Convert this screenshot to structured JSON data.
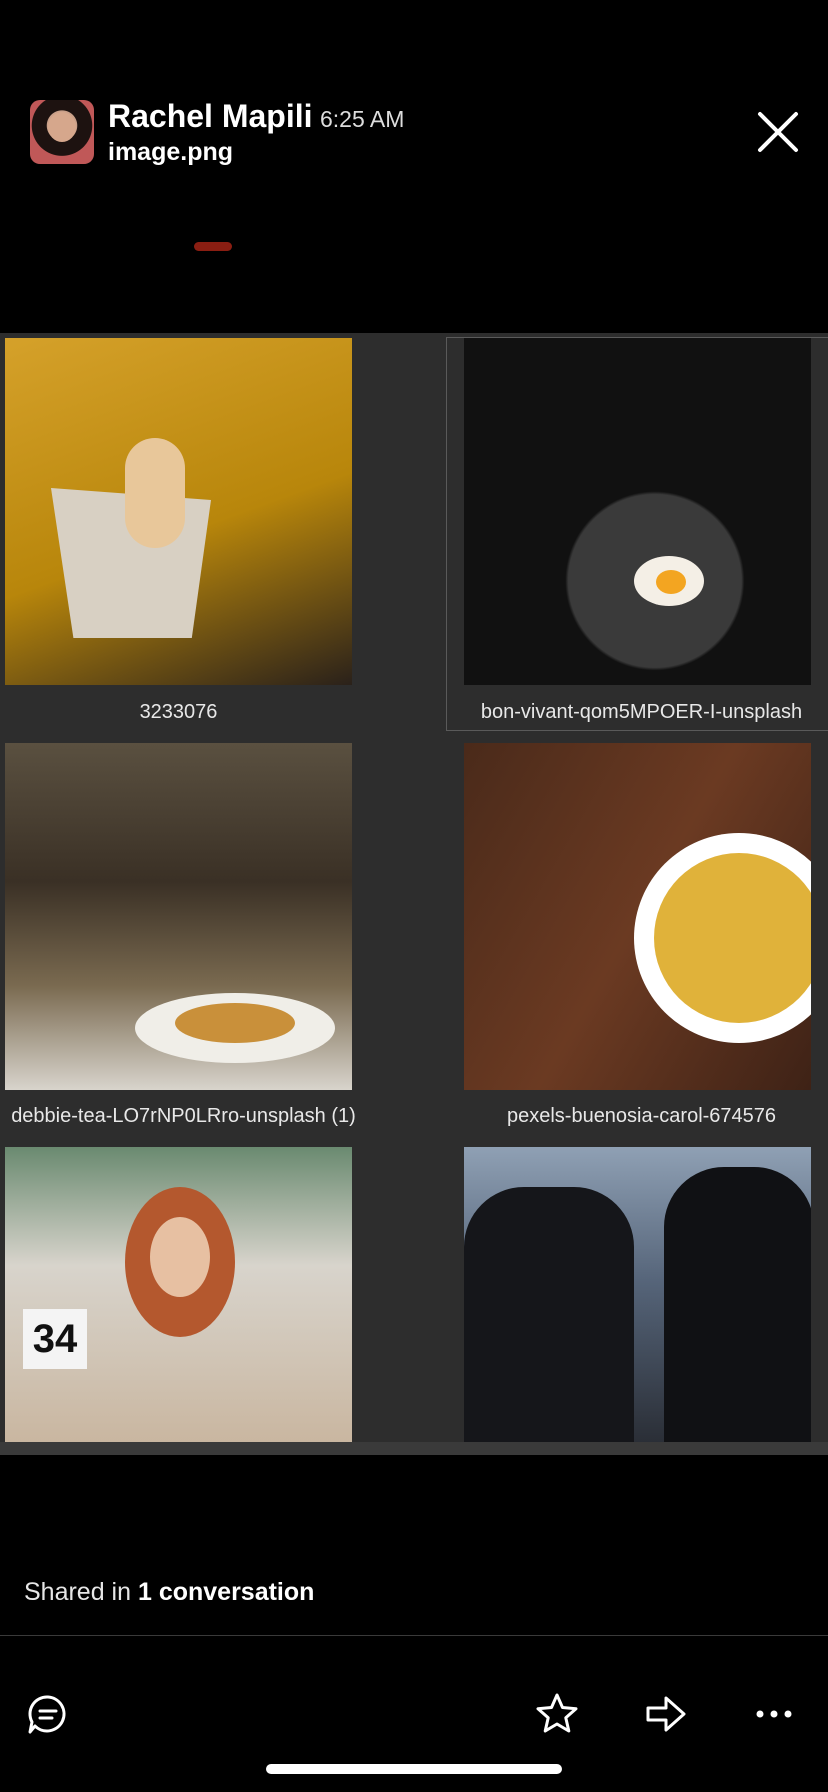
{
  "header": {
    "sender_name": "Rachel Mapili",
    "time": "6:25 AM",
    "file_name": "image.png"
  },
  "gallery": {
    "items": [
      {
        "caption": "3233076"
      },
      {
        "caption": "bon-vivant-qom5MPOER-I-unsplash"
      },
      {
        "caption": "debbie-tea-LO7rNP0LRro-unsplash (1)"
      },
      {
        "caption": "pexels-buenosia-carol-674576"
      },
      {
        "caption": "",
        "badge": "34"
      },
      {
        "caption": ""
      }
    ]
  },
  "footer": {
    "shared_prefix": "Shared in ",
    "shared_count": "1 conversation"
  },
  "icons": {
    "close": "close-icon",
    "comment": "comment-icon",
    "star": "star-icon",
    "share": "share-icon",
    "more": "more-icon"
  }
}
